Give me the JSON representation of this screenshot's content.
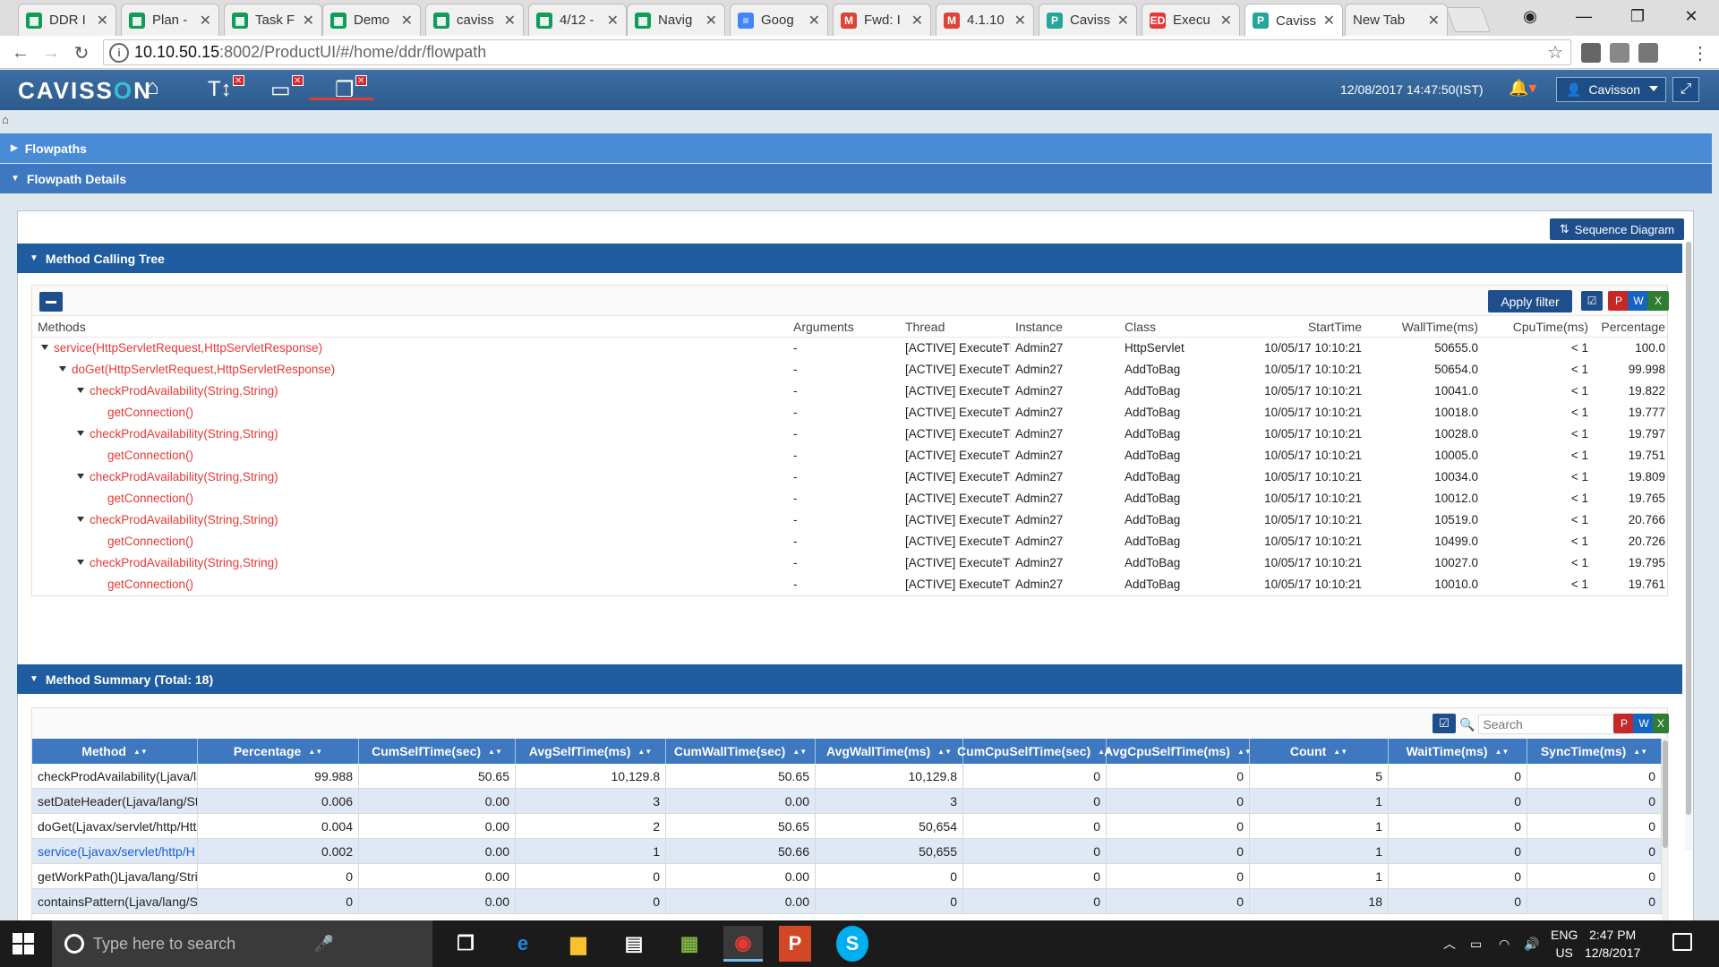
{
  "browser": {
    "tabs": [
      {
        "title": "DDR I",
        "color": "#0f9d58",
        "glyph": "▦"
      },
      {
        "title": "Plan -",
        "color": "#0f9d58",
        "glyph": "▦"
      },
      {
        "title": "Task F",
        "color": "#0f9d58",
        "glyph": "▦"
      },
      {
        "title": "Demo",
        "color": "#0f9d58",
        "glyph": "▦"
      },
      {
        "title": "caviss",
        "color": "#0f9d58",
        "glyph": "▦"
      },
      {
        "title": "4/12 -",
        "color": "#0f9d58",
        "glyph": "▦"
      },
      {
        "title": "Navig",
        "color": "#0f9d58",
        "glyph": "▦"
      },
      {
        "title": "Goog",
        "color": "#4285f4",
        "glyph": "≡"
      },
      {
        "title": "Fwd: I",
        "color": "#db4437",
        "glyph": "M"
      },
      {
        "title": "4.1.10",
        "color": "#db4437",
        "glyph": "M"
      },
      {
        "title": "Caviss",
        "color": "#26a69a",
        "glyph": "P"
      },
      {
        "title": "Execu",
        "color": "#e53935",
        "glyph": "ED"
      },
      {
        "title": "Caviss",
        "color": "#26a69a",
        "glyph": "P"
      },
      {
        "title": "New Tab",
        "color": "",
        "glyph": ""
      }
    ],
    "url_host": "10.10.50.15",
    "url_path": ":8002/ProductUI/#/home/ddr/flowpath"
  },
  "app": {
    "logo_prefix": "CAVISS",
    "logo_o": "O",
    "logo_suffix": "N",
    "datetime": "12/08/2017 14:47:50(IST)",
    "user": "Cavisson"
  },
  "accordions": {
    "flowpaths": "Flowpaths",
    "flowpath_details": "Flowpath Details"
  },
  "sequence_button": "Sequence Diagram",
  "tree": {
    "title": "Method Calling Tree",
    "apply_filter": "Apply filter",
    "headers": [
      "Methods",
      "Arguments",
      "Thread",
      "Instance",
      "Class",
      "StartTime",
      "WallTime(ms)",
      "CpuTime(ms)",
      "Percentage"
    ],
    "rows": [
      {
        "method": "service(HttpServletRequest,HttpServletResponse)",
        "depth": 0,
        "expanded": true,
        "args": "-",
        "thread": "[ACTIVE] ExecuteTl",
        "instance": "Admin27",
        "class": "HttpServlet",
        "start": "10/05/17 10:10:21",
        "wall": "50655.0",
        "cpu": "< 1",
        "pct": "100.0"
      },
      {
        "method": "doGet(HttpServletRequest,HttpServletResponse)",
        "depth": 1,
        "expanded": true,
        "args": "-",
        "thread": "[ACTIVE] ExecuteTl",
        "instance": "Admin27",
        "class": "AddToBag",
        "start": "10/05/17 10:10:21",
        "wall": "50654.0",
        "cpu": "< 1",
        "pct": "99.998"
      },
      {
        "method": "checkProdAvailability(String,String)",
        "depth": 2,
        "expanded": true,
        "args": "-",
        "thread": "[ACTIVE] ExecuteTl",
        "instance": "Admin27",
        "class": "AddToBag",
        "start": "10/05/17 10:10:21",
        "wall": "10041.0",
        "cpu": "< 1",
        "pct": "19.822"
      },
      {
        "method": "getConnection()",
        "depth": 3,
        "expanded": false,
        "args": "-",
        "thread": "[ACTIVE] ExecuteTl",
        "instance": "Admin27",
        "class": "AddToBag",
        "start": "10/05/17 10:10:21",
        "wall": "10018.0",
        "cpu": "< 1",
        "pct": "19.777"
      },
      {
        "method": "checkProdAvailability(String,String)",
        "depth": 2,
        "expanded": true,
        "args": "-",
        "thread": "[ACTIVE] ExecuteTl",
        "instance": "Admin27",
        "class": "AddToBag",
        "start": "10/05/17 10:10:21",
        "wall": "10028.0",
        "cpu": "< 1",
        "pct": "19.797"
      },
      {
        "method": "getConnection()",
        "depth": 3,
        "expanded": false,
        "args": "-",
        "thread": "[ACTIVE] ExecuteTl",
        "instance": "Admin27",
        "class": "AddToBag",
        "start": "10/05/17 10:10:21",
        "wall": "10005.0",
        "cpu": "< 1",
        "pct": "19.751"
      },
      {
        "method": "checkProdAvailability(String,String)",
        "depth": 2,
        "expanded": true,
        "args": "-",
        "thread": "[ACTIVE] ExecuteTl",
        "instance": "Admin27",
        "class": "AddToBag",
        "start": "10/05/17 10:10:21",
        "wall": "10034.0",
        "cpu": "< 1",
        "pct": "19.809"
      },
      {
        "method": "getConnection()",
        "depth": 3,
        "expanded": false,
        "args": "-",
        "thread": "[ACTIVE] ExecuteTl",
        "instance": "Admin27",
        "class": "AddToBag",
        "start": "10/05/17 10:10:21",
        "wall": "10012.0",
        "cpu": "< 1",
        "pct": "19.765"
      },
      {
        "method": "checkProdAvailability(String,String)",
        "depth": 2,
        "expanded": true,
        "args": "-",
        "thread": "[ACTIVE] ExecuteTl",
        "instance": "Admin27",
        "class": "AddToBag",
        "start": "10/05/17 10:10:21",
        "wall": "10519.0",
        "cpu": "< 1",
        "pct": "20.766"
      },
      {
        "method": "getConnection()",
        "depth": 3,
        "expanded": false,
        "args": "-",
        "thread": "[ACTIVE] ExecuteTl",
        "instance": "Admin27",
        "class": "AddToBag",
        "start": "10/05/17 10:10:21",
        "wall": "10499.0",
        "cpu": "< 1",
        "pct": "20.726"
      },
      {
        "method": "checkProdAvailability(String,String)",
        "depth": 2,
        "expanded": true,
        "args": "-",
        "thread": "[ACTIVE] ExecuteTl",
        "instance": "Admin27",
        "class": "AddToBag",
        "start": "10/05/17 10:10:21",
        "wall": "10027.0",
        "cpu": "< 1",
        "pct": "19.795"
      },
      {
        "method": "getConnection()",
        "depth": 3,
        "expanded": false,
        "args": "-",
        "thread": "[ACTIVE] ExecuteTl",
        "instance": "Admin27",
        "class": "AddToBag",
        "start": "10/05/17 10:10:21",
        "wall": "10010.0",
        "cpu": "< 1",
        "pct": "19.761"
      }
    ]
  },
  "summary": {
    "title": "Method Summary (Total: 18)",
    "search_placeholder": "Search",
    "headers": [
      "Method",
      "Percentage",
      "CumSelfTime(sec)",
      "AvgSelfTime(ms)",
      "CumWallTime(sec)",
      "AvgWallTime(ms)",
      "CumCpuSelfTime(sec)",
      "AvgCpuSelfTime(ms)",
      "Count",
      "WaitTime(ms)",
      "SyncTime(ms)"
    ],
    "rows": [
      [
        "checkProdAvailability(Ljava/la",
        "99.988",
        "50.65",
        "10,129.8",
        "50.65",
        "10,129.8",
        "0",
        "0",
        "5",
        "0",
        "0"
      ],
      [
        "setDateHeader(Ljava/lang/St",
        "0.006",
        "0.00",
        "3",
        "0.00",
        "3",
        "0",
        "0",
        "1",
        "0",
        "0"
      ],
      [
        "doGet(Ljavax/servlet/http/Htt",
        "0.004",
        "0.00",
        "2",
        "50.65",
        "50,654",
        "0",
        "0",
        "1",
        "0",
        "0"
      ],
      [
        "service(Ljavax/servlet/http/H",
        "0.002",
        "0.00",
        "1",
        "50.66",
        "50,655",
        "0",
        "0",
        "1",
        "0",
        "0"
      ],
      [
        "getWorkPath()Ljava/lang/Stri",
        "0",
        "0.00",
        "0",
        "0.00",
        "0",
        "0",
        "0",
        "1",
        "0",
        "0"
      ],
      [
        "containsPattern(Ljava/lang/S",
        "0",
        "0.00",
        "0",
        "0.00",
        "0",
        "0",
        "0",
        "18",
        "0",
        "0"
      ]
    ]
  },
  "taskbar": {
    "search_placeholder": "Type here to search",
    "lang": "ENG",
    "region": "US",
    "time": "2:47 PM",
    "date": "12/8/2017"
  }
}
